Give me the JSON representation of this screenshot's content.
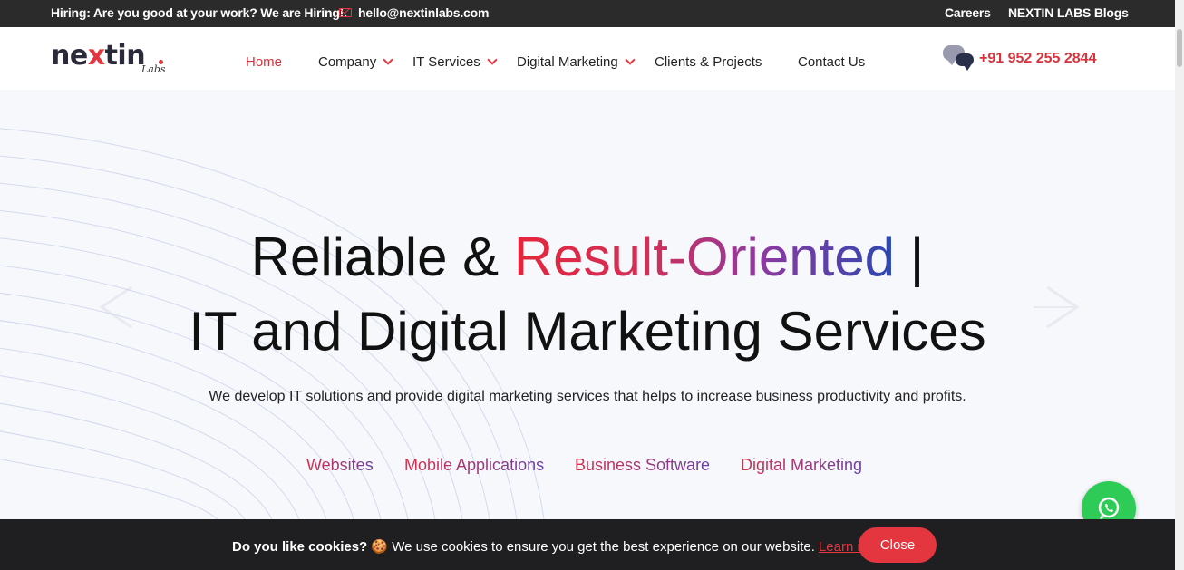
{
  "topbar": {
    "hiring_label": "Hiring:",
    "hiring_text": "Are you good at your work? We are Hiring!.",
    "email": "hello@nextinlabs.com",
    "careers": "Careers",
    "blogs": "NEXTIN LABS Blogs"
  },
  "logo": {
    "word_a": "ne",
    "word_x": "x",
    "word_b": "tin",
    "sub": "Labs"
  },
  "nav": {
    "home": "Home",
    "company": "Company",
    "it_services": "IT Services",
    "digital_marketing": "Digital Marketing",
    "clients": "Clients & Projects",
    "contact": "Contact Us"
  },
  "phone": "+91 952 255 2844",
  "hero": {
    "line1_a": "Reliable & ",
    "line1_grad": "Result-Oriented",
    "line1_bar": " |",
    "line2": "IT and Digital Marketing Services",
    "subtext": "We develop IT solutions and provide digital marketing services that helps to increase business productivity and profits.",
    "tags": [
      "Websites",
      "Mobile Applications",
      "Business Software",
      "Digital Marketing"
    ]
  },
  "cookie": {
    "bold": "Do you like cookies?",
    "emoji": "🍪",
    "text": "We use cookies to ensure you get the best experience on our website.",
    "learn": "Learn more",
    "close": "Close"
  },
  "colors": {
    "accent": "#e4363f",
    "dark": "#2b2b2b",
    "whatsapp": "#2ecc57"
  }
}
